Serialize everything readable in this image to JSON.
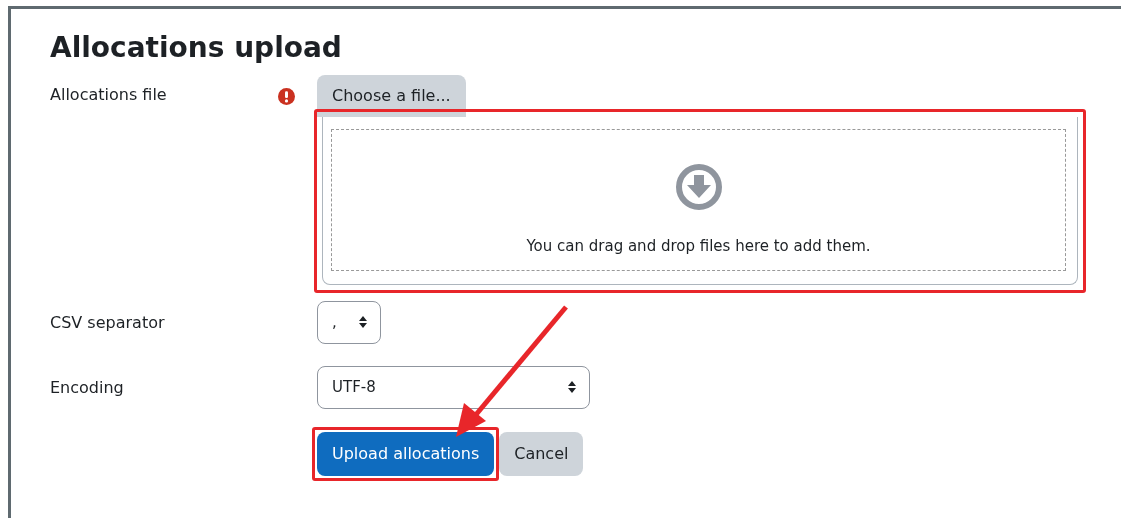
{
  "title": "Allocations upload",
  "fields": [
    {
      "kind": "file",
      "label": "Allocations file",
      "required": true,
      "button": "Choose a file...",
      "dropzone_text": "You can drag and drop files here to add them."
    },
    {
      "kind": "compact",
      "label": "CSV separator",
      "value": ","
    },
    {
      "kind": "select",
      "label": "Encoding",
      "value": "UTF-8"
    }
  ],
  "buttons": [
    {
      "label": "Upload allocations",
      "primary": true
    },
    {
      "label": "Cancel",
      "primary": false
    }
  ]
}
